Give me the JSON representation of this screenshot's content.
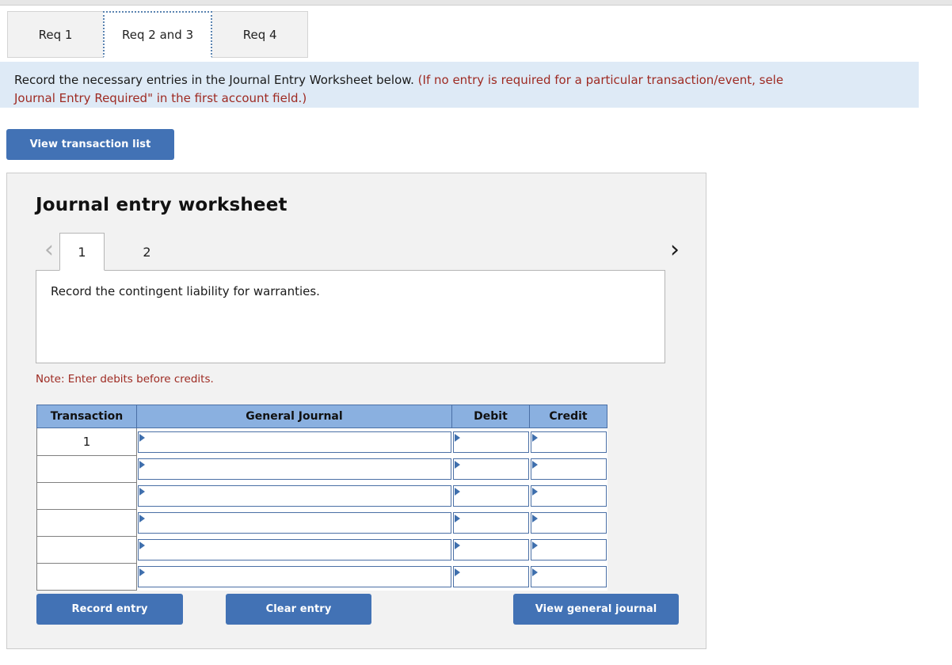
{
  "tabs": [
    {
      "label": "Req 1",
      "active": false
    },
    {
      "label": "Req 2 and 3",
      "active": true
    },
    {
      "label": "Req 4",
      "active": false
    }
  ],
  "banner": {
    "line1_black": "Record the necessary entries in the Journal Entry Worksheet below.",
    "line1_red": " (If no entry is required for a particular transaction/event, sele",
    "line2_red": "Journal Entry Required\" in the first account field.)"
  },
  "view_transaction_list_label": "View transaction list",
  "worksheet": {
    "title": "Journal entry worksheet",
    "prev_icon": "‹",
    "next_icon": "›",
    "pages": [
      {
        "label": "1",
        "active": true
      },
      {
        "label": "2",
        "active": false
      }
    ],
    "description": "Record the contingent liability for warranties.",
    "note": "Note: Enter debits before credits.",
    "columns": [
      "Transaction",
      "General Journal",
      "Debit",
      "Credit"
    ],
    "rows": [
      {
        "transaction": "1",
        "general_journal": "",
        "debit": "",
        "credit": ""
      },
      {
        "transaction": "",
        "general_journal": "",
        "debit": "",
        "credit": ""
      },
      {
        "transaction": "",
        "general_journal": "",
        "debit": "",
        "credit": ""
      },
      {
        "transaction": "",
        "general_journal": "",
        "debit": "",
        "credit": ""
      },
      {
        "transaction": "",
        "general_journal": "",
        "debit": "",
        "credit": ""
      },
      {
        "transaction": "",
        "general_journal": "",
        "debit": "",
        "credit": ""
      }
    ],
    "record_entry_label": "Record entry",
    "clear_entry_label": "Clear entry",
    "view_general_journal_label": "View general journal"
  },
  "colors": {
    "button_blue": "#4272b5",
    "table_header_blue": "#8ab0e0",
    "banner_blue": "#deeaf6",
    "note_red": "#9e2a22",
    "panel_gray": "#f2f2f2"
  }
}
